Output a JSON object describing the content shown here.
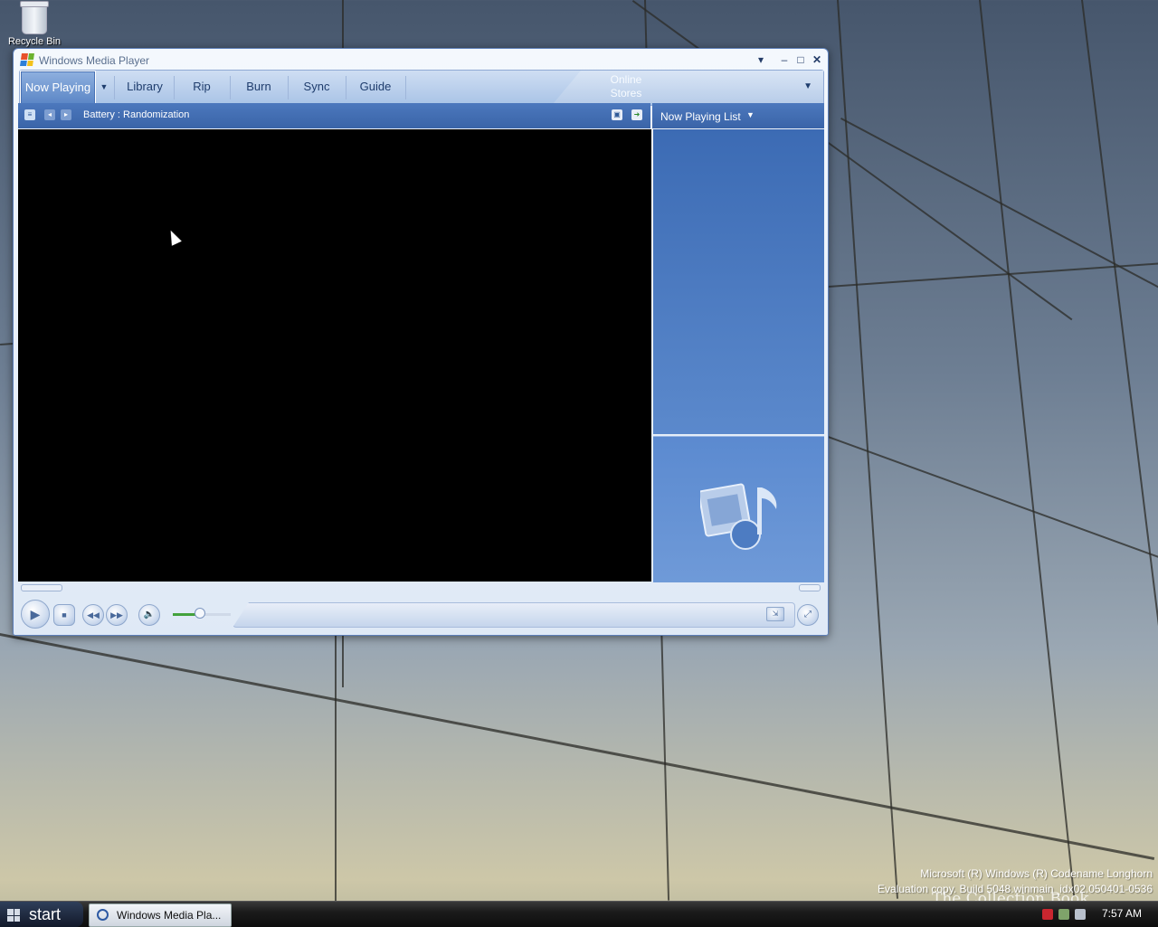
{
  "desktop": {
    "recycle_bin_label": "Recycle Bin",
    "watermark_line1": "Microsoft (R) Windows (R) Codename Longhorn",
    "watermark_line2": "Evaluation copy. Build 5048.winmain_idx02.050401-0536",
    "overlay_text": "The Collection Book"
  },
  "window": {
    "title": "Windows Media Player",
    "controls": {
      "menu": "▾",
      "minimize": "–",
      "maximize": "□",
      "close": "✕"
    }
  },
  "tabs": [
    {
      "label": "Now Playing",
      "active": true
    },
    {
      "label": "Library"
    },
    {
      "label": "Rip"
    },
    {
      "label": "Burn"
    },
    {
      "label": "Sync"
    },
    {
      "label": "Guide"
    }
  ],
  "online_stores": {
    "label": "Online Stores"
  },
  "info_bar": {
    "track": "Battery : Randomization"
  },
  "now_playing": {
    "title": "Now Playing List"
  },
  "playback": {
    "volume_level": 0.45
  },
  "taskbar": {
    "start_label": "start",
    "task_label": "Windows Media Pla...",
    "clock": "7:57 AM"
  },
  "colors": {
    "accent": "#3a64a8",
    "video_bg": "#000000"
  }
}
